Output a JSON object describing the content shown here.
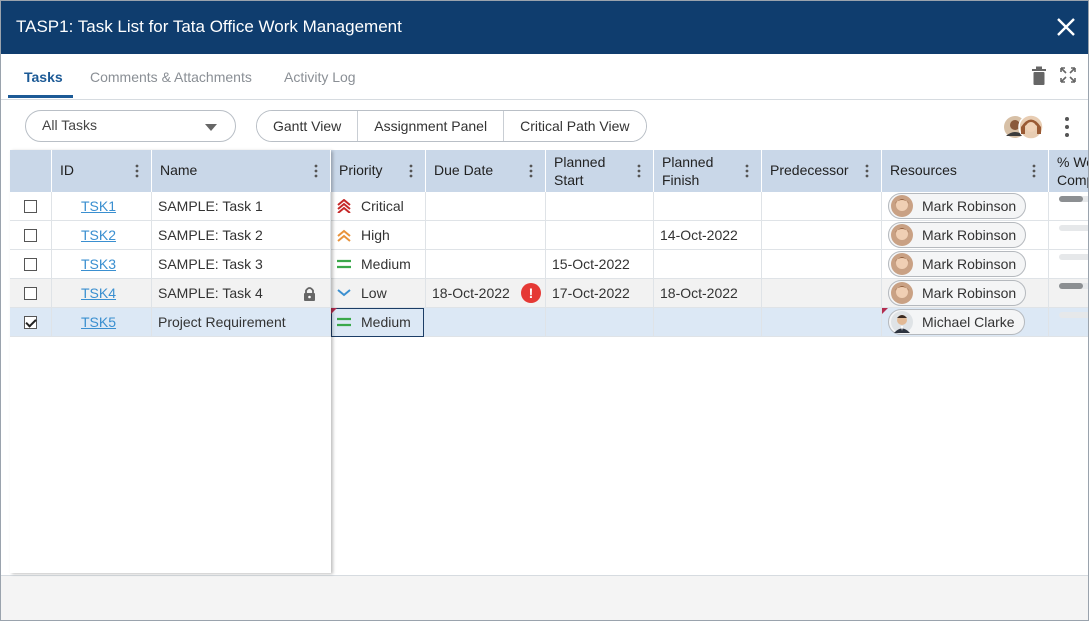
{
  "window": {
    "title": "TASP1: Task List for Tata Office Work Management"
  },
  "tabs": [
    {
      "label": "Tasks",
      "active": true
    },
    {
      "label": "Comments & Attachments",
      "active": false
    },
    {
      "label": "Activity Log",
      "active": false
    }
  ],
  "toolbar": {
    "filter_value": "All Tasks",
    "views": [
      "Gantt View",
      "Assignment Panel",
      "Critical Path View"
    ]
  },
  "grid": {
    "columns": [
      "ID",
      "Name",
      "Priority",
      "Due Date",
      "Planned Start",
      "Planned Finish",
      "Predecessor",
      "Resources",
      "% Wo Comp"
    ],
    "rows": [
      {
        "checked": false,
        "id": "TSK1",
        "name": "SAMPLE: Task 1",
        "priority": "Critical",
        "due": "",
        "start": "",
        "finish": "",
        "pred": "",
        "resource": "Mark Robinson",
        "progress": 0.6
      },
      {
        "checked": false,
        "id": "TSK2",
        "name": "SAMPLE: Task 2",
        "priority": "High",
        "due": "",
        "start": "",
        "finish": "14-Oct-2022",
        "pred": "",
        "resource": "Mark Robinson",
        "progress": 0.0
      },
      {
        "checked": false,
        "id": "TSK3",
        "name": "SAMPLE: Task 3",
        "priority": "Medium",
        "due": "",
        "start": "15-Oct-2022",
        "finish": "",
        "pred": "",
        "resource": "Mark Robinson",
        "progress": 0.0
      },
      {
        "checked": false,
        "id": "TSK4",
        "name": "SAMPLE: Task 4",
        "priority": "Low",
        "due": "18-Oct-2022",
        "start": "17-Oct-2022",
        "finish": "18-Oct-2022",
        "pred": "",
        "resource": "Mark Robinson",
        "progress": 0.6,
        "locked": true,
        "warning": "!"
      },
      {
        "checked": true,
        "id": "TSK5",
        "name": "Project Requirement",
        "priority": "Medium",
        "due": "",
        "start": "",
        "finish": "",
        "pred": "",
        "resource": "Michael Clarke",
        "progress": 0.0
      }
    ]
  },
  "colors": {
    "header_bg": "#0f3d6e",
    "accent": "#1c5a96",
    "critical": "#c62828",
    "high": "#e8923a",
    "medium": "#3aa84a",
    "low": "#3a8fd0",
    "selected_row": "#dce8f5"
  },
  "icons": [
    "close-icon",
    "trash-icon",
    "expand-icon",
    "caret-down-icon",
    "avatar-group-icon",
    "more-vertical-icon",
    "lock-icon",
    "alert-icon"
  ]
}
